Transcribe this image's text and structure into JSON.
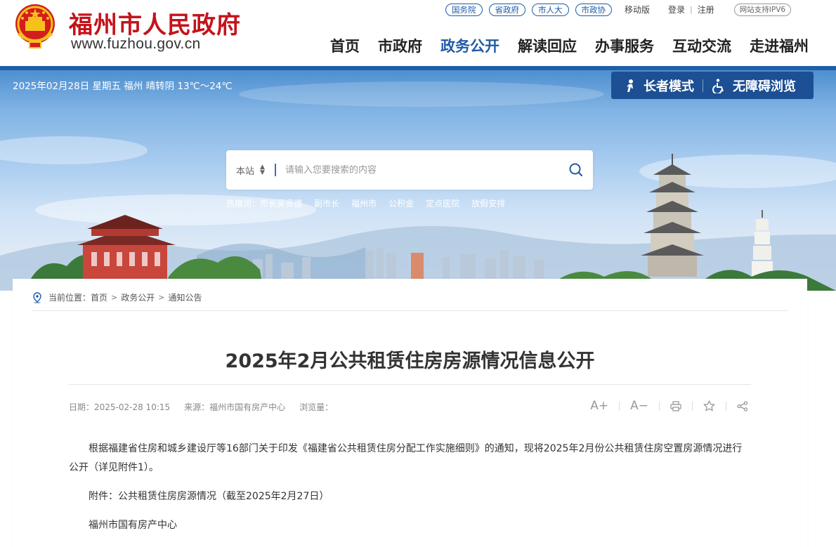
{
  "header": {
    "site_name": "福州市人民政府",
    "site_url": "www.fuzhou.gov.cn",
    "top_links": [
      "国务院",
      "省政府",
      "市人大",
      "市政协"
    ],
    "mobile": "移动版",
    "login": "登录",
    "register": "注册",
    "ipv6": "网站支持IPV6",
    "nav": [
      "首页",
      "市政府",
      "政务公开",
      "解读回应",
      "办事服务",
      "互动交流",
      "走进福州"
    ],
    "active_nav": "政务公开",
    "brand_color": "#c4131b",
    "accent_color": "#1e5ba8"
  },
  "banner": {
    "date_weather": "2025年02月28日 星期五   福州 晴转阴 13℃～24℃",
    "elder_mode": "长者模式",
    "accessible": "无障碍浏览",
    "search": {
      "scope": "本站",
      "placeholder": "请输入您要搜索的内容"
    },
    "hot_label": "热搜词：",
    "hot_words": [
      "市长吴贤德",
      "副市长",
      "福州市",
      "公积金",
      "定点医院",
      "放假安排"
    ]
  },
  "article": {
    "breadcrumb_label": "当前位置：",
    "breadcrumb": [
      "首页",
      "政务公开",
      "通知公告"
    ],
    "title": "2025年2月公共租赁住房房源情况信息公开",
    "date": "日期：2025-02-28 10:15",
    "source": "来源：福州市国有房产中心",
    "views": "浏览量：",
    "tools": {
      "font_up": "A+",
      "font_down": "A−"
    },
    "paragraphs": [
      "根据福建省住房和城乡建设厅等16部门关于印发《福建省公共租赁住房分配工作实施细则》的通知，现将2025年2月份公共租赁住房空置房源情况进行公开（详见附件1）。",
      "附件：公共租赁住房房源情况（截至2025年2月27日）",
      "福州市国有房产中心"
    ]
  }
}
